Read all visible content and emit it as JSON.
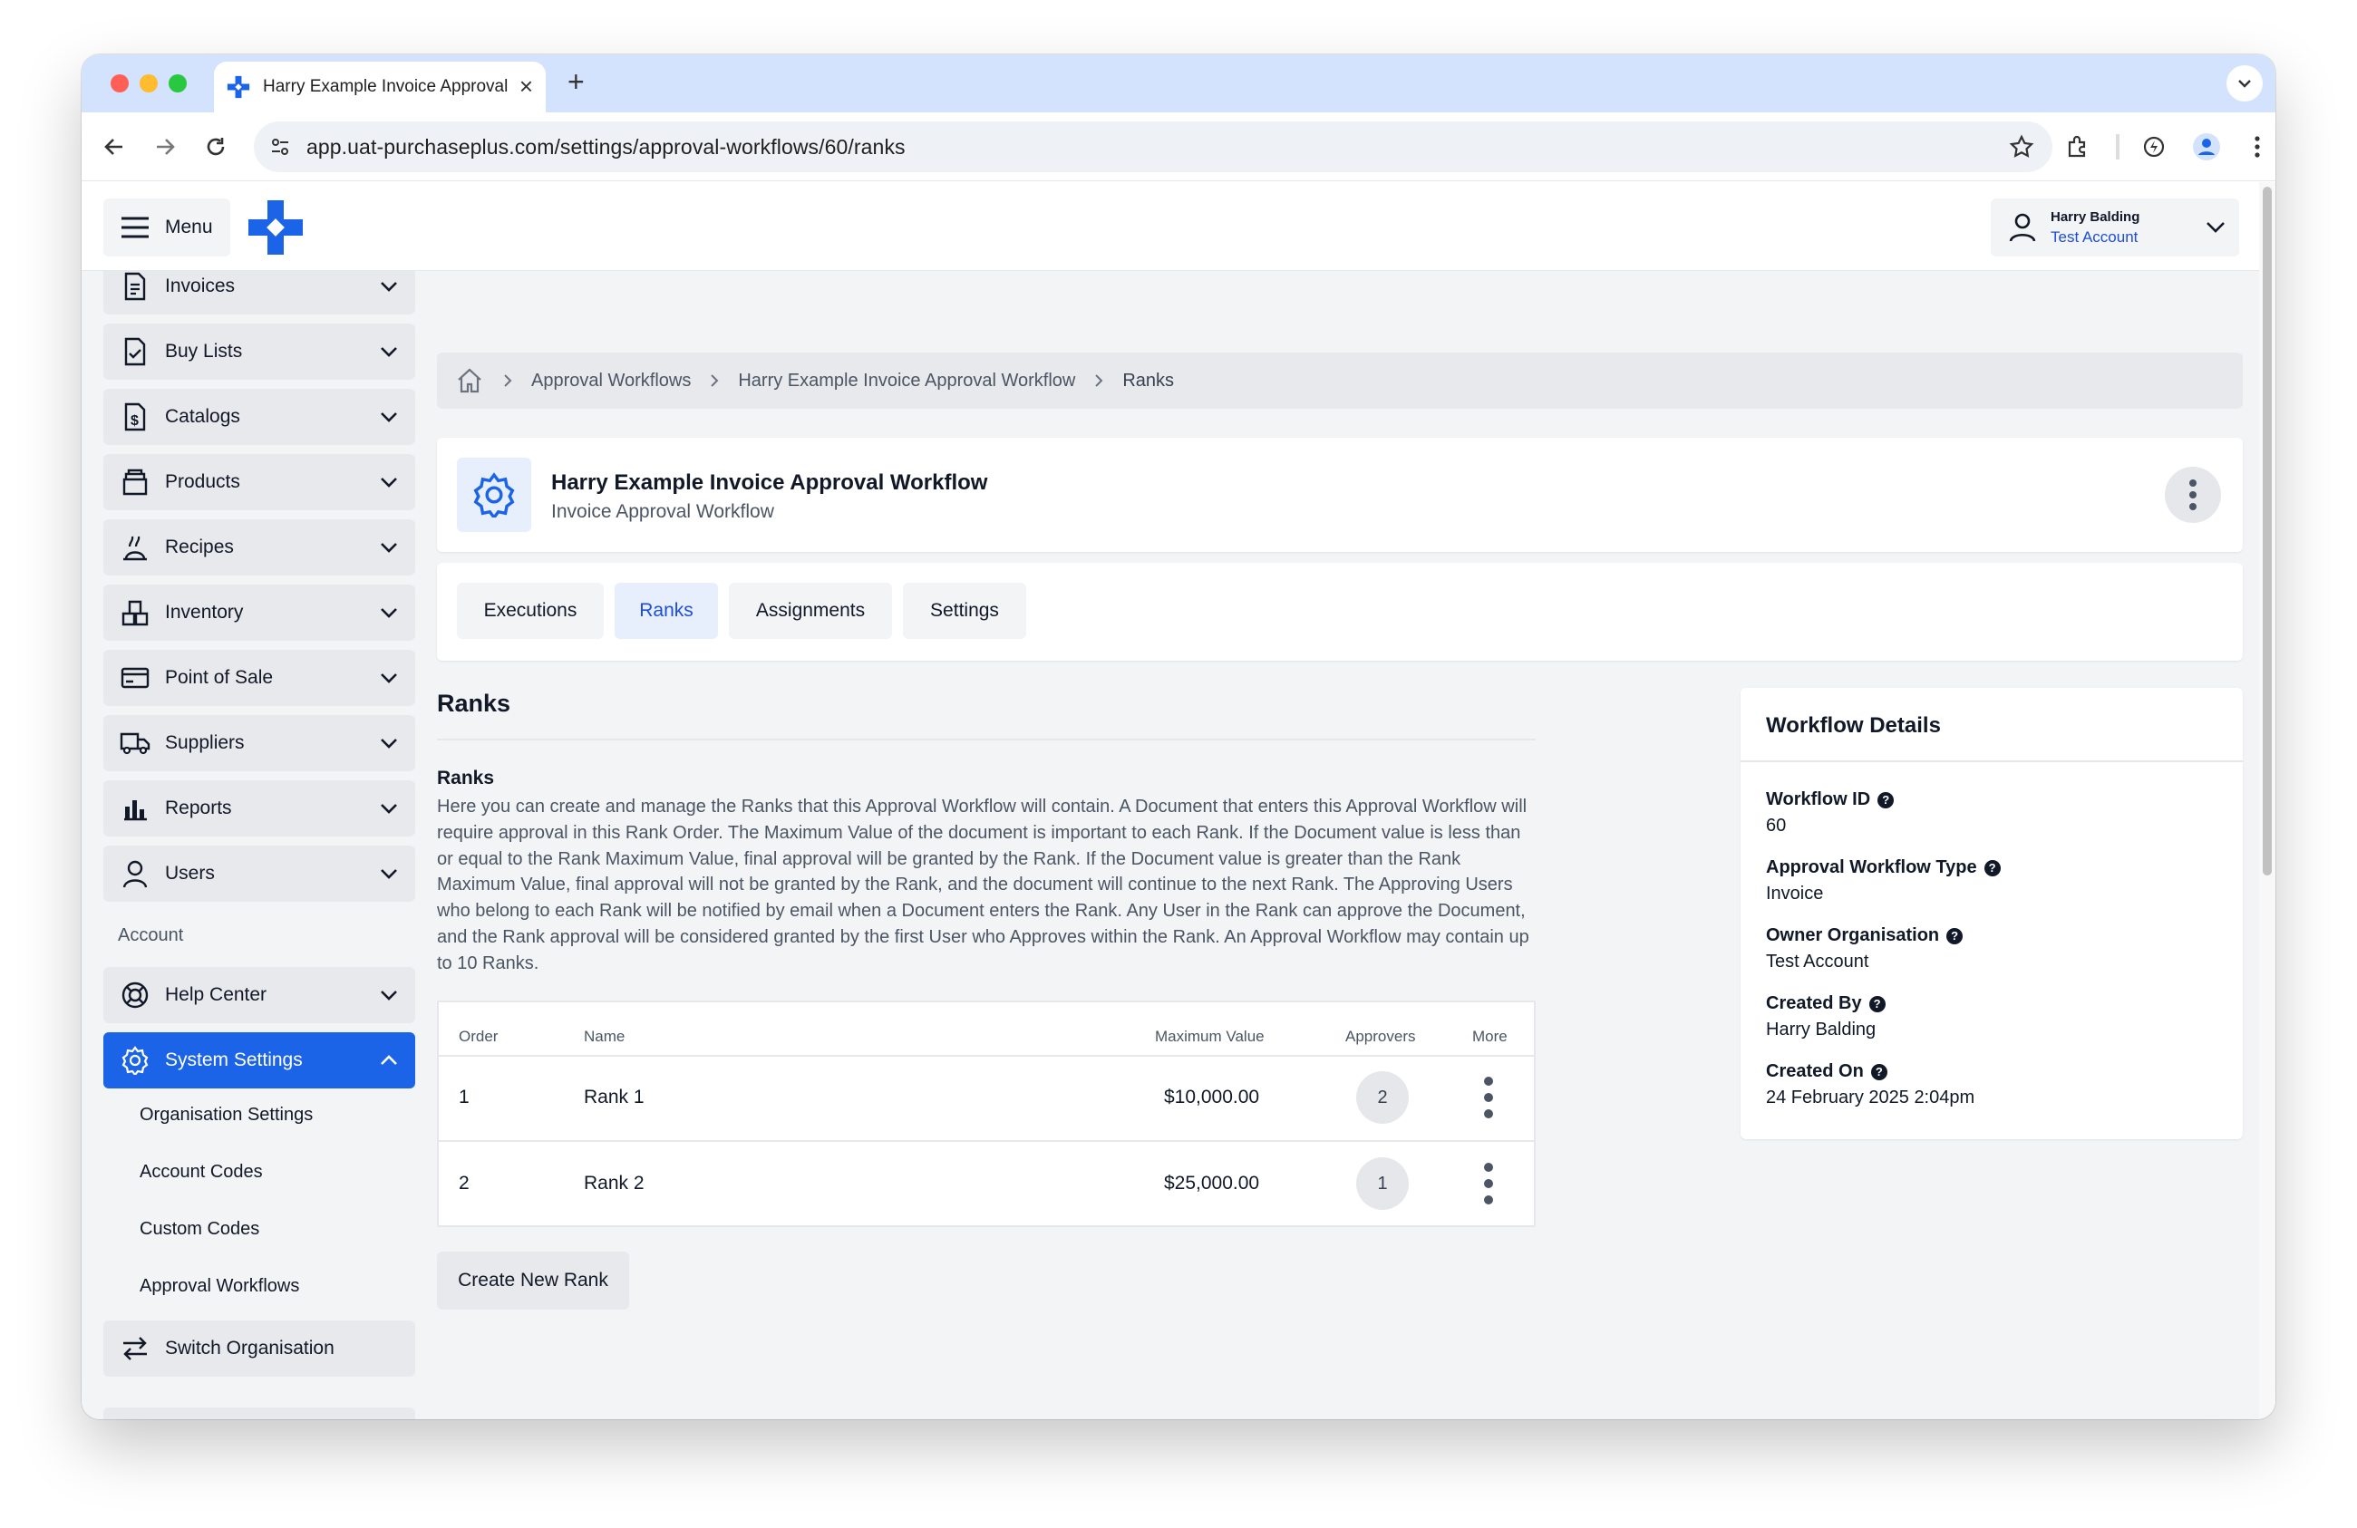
{
  "browser": {
    "tab_title": "Harry Example Invoice Approval Workflow",
    "url": "app.uat-purchaseplus.com/settings/approval-workflows/60/ranks"
  },
  "header": {
    "menu_label": "Menu",
    "user_name": "Harry Balding",
    "user_account": "Test Account"
  },
  "sidebar": {
    "items": [
      {
        "label": "Invoices",
        "icon": "invoice-icon"
      },
      {
        "label": "Buy Lists",
        "icon": "checklist-icon"
      },
      {
        "label": "Catalogs",
        "icon": "catalog-icon"
      },
      {
        "label": "Products",
        "icon": "products-icon"
      },
      {
        "label": "Recipes",
        "icon": "recipes-icon"
      },
      {
        "label": "Inventory",
        "icon": "inventory-icon"
      },
      {
        "label": "Point of Sale",
        "icon": "card-icon"
      },
      {
        "label": "Suppliers",
        "icon": "truck-icon"
      },
      {
        "label": "Reports",
        "icon": "bar-chart-icon"
      },
      {
        "label": "Users",
        "icon": "user-icon"
      }
    ],
    "account_label": "Account",
    "help_center": "Help Center",
    "system_settings": "System Settings",
    "sub_items": [
      "Organisation Settings",
      "Account Codes",
      "Custom Codes",
      "Approval Workflows"
    ],
    "switch_org": "Switch Organisation"
  },
  "breadcrumb": {
    "items": [
      "Approval Workflows",
      "Harry Example Invoice Approval Workflow",
      "Ranks"
    ]
  },
  "workflow": {
    "title": "Harry Example Invoice Approval Workflow",
    "subtitle": "Invoice Approval Workflow"
  },
  "tabs": [
    {
      "label": "Executions",
      "selected": false
    },
    {
      "label": "Ranks",
      "selected": true
    },
    {
      "label": "Assignments",
      "selected": false
    },
    {
      "label": "Settings",
      "selected": false
    }
  ],
  "ranks_section": {
    "title": "Ranks",
    "heading": "Ranks",
    "description": "Here you can create and manage the Ranks that this Approval Workflow will contain. A Document that enters this Approval Workflow will require approval in this Rank Order. The Maximum Value of the document is important to each Rank. If the Document value is less than or equal to the Rank Maximum Value, final approval will be granted by the Rank. If the Document value is greater than the Rank Maximum Value, final approval will not be granted by the Rank, and the document will continue to the next Rank. The Approving Users who belong to each Rank will be notified by email when a Document enters the Rank. Any User in the Rank can approve the Document, and the Rank approval will be considered granted by the first User who Approves within the Rank. An Approval Workflow may contain up to 10 Ranks."
  },
  "table": {
    "columns": [
      "Order",
      "Name",
      "Maximum Value",
      "Approvers",
      "More"
    ],
    "rows": [
      {
        "order": "1",
        "name": "Rank 1",
        "max_value": "$10,000.00",
        "approvers": "2"
      },
      {
        "order": "2",
        "name": "Rank 2",
        "max_value": "$25,000.00",
        "approvers": "1"
      }
    ]
  },
  "create_button": "Create New Rank",
  "details": {
    "title": "Workflow Details",
    "fields": [
      {
        "label": "Workflow ID",
        "value": "60"
      },
      {
        "label": "Approval Workflow Type",
        "value": "Invoice"
      },
      {
        "label": "Owner Organisation",
        "value": "Test Account"
      },
      {
        "label": "Created By",
        "value": "Harry Balding"
      },
      {
        "label": "Created On",
        "value": "24 February 2025 2:04pm"
      }
    ]
  },
  "colors": {
    "accent": "#1c64e7",
    "tab_bar": "#d3e3fd",
    "page_bg": "#f3f4f6"
  }
}
